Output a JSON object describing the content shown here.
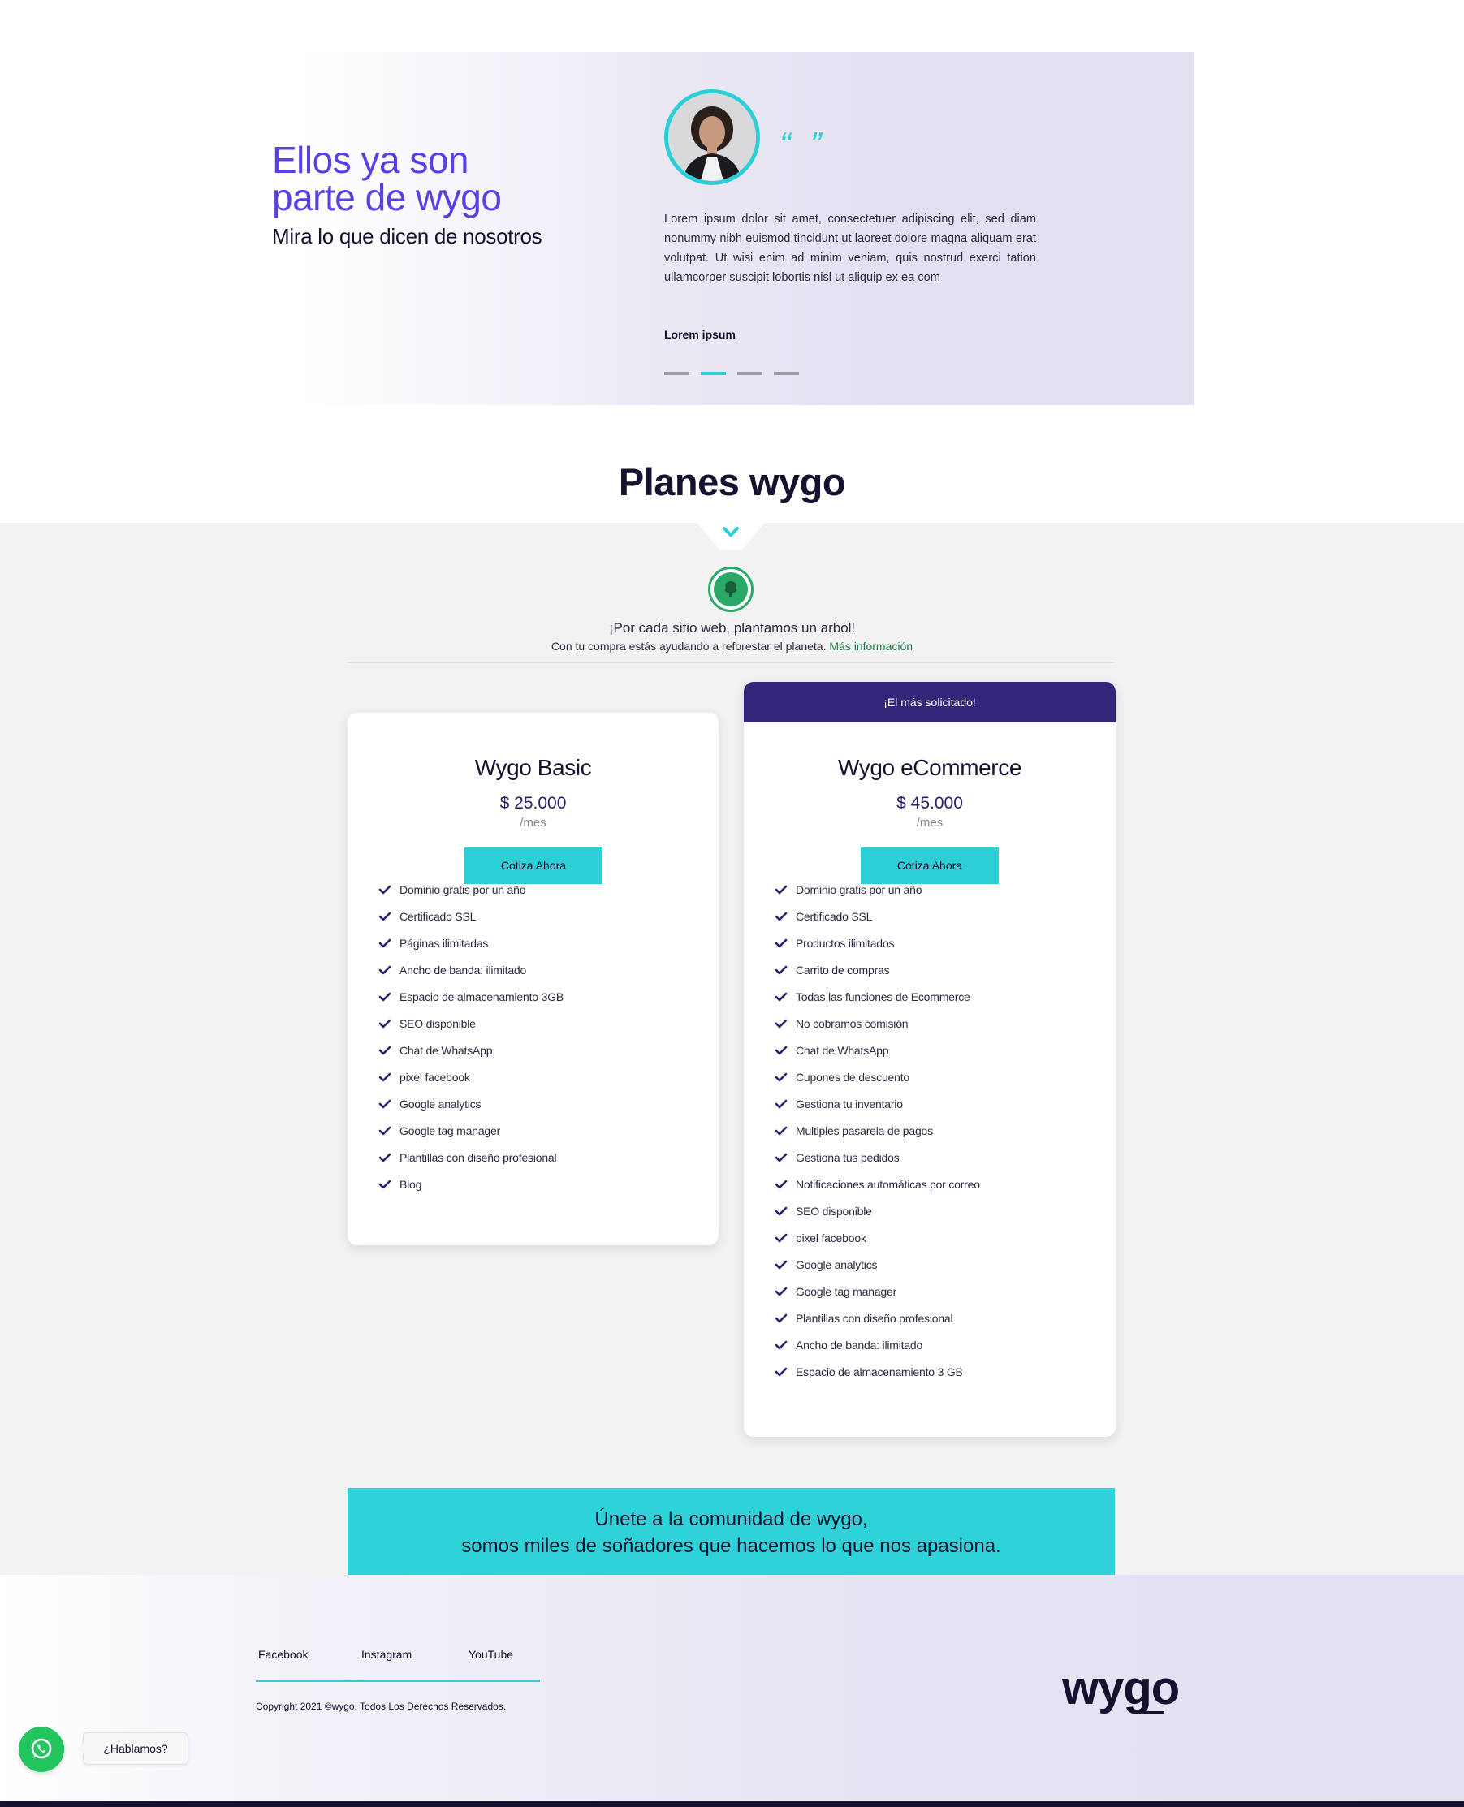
{
  "testimonial": {
    "title_line1": "Ellos ya son",
    "title_line2": "parte de wygo",
    "subtitle": "Mira lo que dicen de nosotros",
    "quote_mark": "“ ”",
    "text": "Lorem ipsum dolor sit amet, consectetuer adipiscing elit, sed diam nonummy nibh euismod tincidunt ut laoreet dolore magna aliquam erat volutpat. Ut wisi enim ad minim veniam, quis nostrud exerci tation ullamcorper suscipit lobortis nisl ut aliquip ex ea com",
    "author": "Lorem ipsum",
    "slides": 4,
    "active_slide": 2
  },
  "plans": {
    "title": "Planes wygo",
    "tree_line1": "¡Por cada sitio web, plantamos un arbol!",
    "tree_line2": "Con tu compra estás ayudando a reforestar el planeta.",
    "tree_link": "Más información"
  },
  "basic": {
    "title": "Wygo Basic",
    "price": "$ 25.000",
    "period": "/mes",
    "cta": "Cotiza Ahora",
    "features": [
      "Dominio gratis por un año",
      "Certificado SSL",
      "Páginas ilimitadas",
      "Ancho de banda: ilimitado",
      "Espacio de almacenamiento 3GB",
      "SEO disponible",
      "Chat de WhatsApp",
      "pixel facebook",
      "Google analytics",
      "Google tag manager",
      "Plantillas con diseño profesional",
      "Blog"
    ]
  },
  "ecommerce": {
    "badge": "¡El más solicitado!",
    "title": "Wygo eCommerce",
    "price": "$ 45.000",
    "period": "/mes",
    "cta": "Cotiza Ahora",
    "features": [
      "Dominio gratis por un año",
      "Certificado SSL",
      "Productos ilimitados",
      "Carrito de compras",
      "Todas las funciones de Ecommerce",
      "No cobramos comisión",
      "Chat de WhatsApp",
      "Cupones de descuento",
      "Gestiona tu inventario",
      "Multiples pasarela de pagos",
      "Gestiona tus pedidos",
      "Notificaciones automáticas por correo",
      "SEO disponible",
      "pixel facebook",
      "Google analytics",
      "Google tag manager",
      "Plantillas con diseño profesional",
      "Ancho de banda: ilimitado",
      "Espacio de almacenamiento 3 GB"
    ]
  },
  "banner": {
    "line1": "Únete a la comunidad de wygo,",
    "line2": "somos miles de soñadores que hacemos lo que nos apasiona."
  },
  "footer": {
    "social": [
      "Facebook",
      "Instagram",
      "YouTube"
    ],
    "copyright": "Copyright 2021 ©wygo. Todos Los Derechos Reservados.",
    "logo": "wygo"
  },
  "whatsapp": {
    "label": "¿Hablamos?"
  },
  "colors": {
    "accent": "#2dcfd6",
    "purple": "#5b3fe2",
    "dark": "#14122e",
    "badge": "#33267a",
    "check": "#26226b"
  },
  "icons": [
    "quote-icon",
    "chevron-down-icon",
    "tree-icon",
    "check-icon",
    "whatsapp-icon"
  ]
}
